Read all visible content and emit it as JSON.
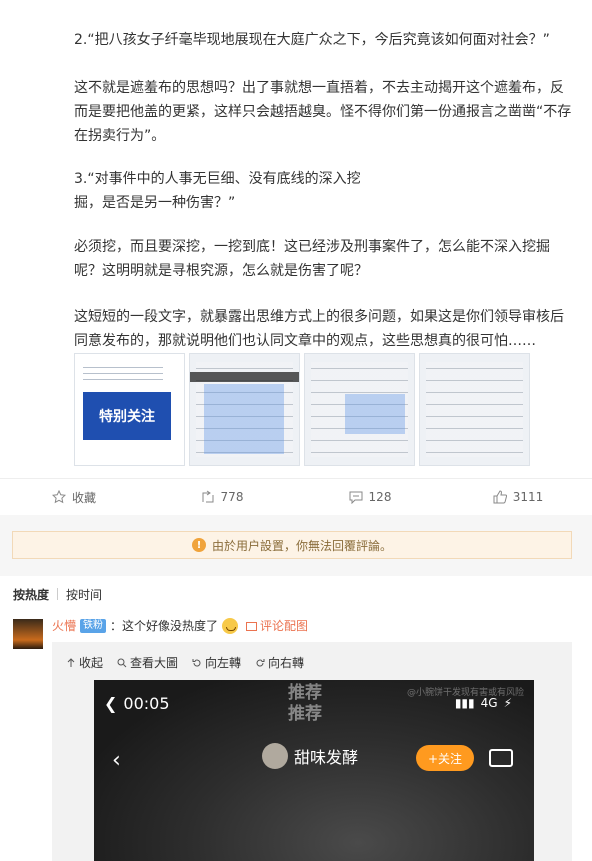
{
  "article": {
    "paragraphs": [
      "2.“把八孩女子纤毫毕现地展现在大庭广众之下，今后究竟该如何面对社会？”",
      "这不就是遮羞布的思想吗？出了事就想一直捂着，不去主动揭开这个遮羞布，反而是要把他盖的更紧，这样只会越捂越臭。怪不得你们第一份通报言之凿凿“不存在拐卖行为”。",
      "3.“对事件中的人事无巨细、没有底线的深入挖",
      "掘，是否是另一种伤害？”",
      "必须挖，而且要深挖，一挖到底！这已经涉及刑事案件了，怎么能不深入挖掘呢？这明明就是寻根究源，怎么就是伤害了呢？",
      "这短短的一段文字，就暴露出思维方式上的很多问题，如果这是你们领导审核后同意发布的，那就说明他们也认同文章中的观点，这些思想真的很可怕……"
    ],
    "thumbnails": [
      {
        "banner": "特别关注"
      },
      {},
      {},
      {}
    ]
  },
  "actions": [
    {
      "icon": "star-icon",
      "label": "收藏"
    },
    {
      "icon": "repost-icon",
      "label": "778"
    },
    {
      "icon": "comment-icon",
      "label": "128"
    },
    {
      "icon": "like-icon",
      "label": "3111"
    }
  ],
  "notice": {
    "icon": "alert-icon",
    "text": "由於用户設置，你無法回覆評論。"
  },
  "sort": {
    "hot": "按热度",
    "time": "按时间",
    "active": "hot"
  },
  "comment": {
    "username": "火懵",
    "badge": "铁粉",
    "text": "：这个好像没热度了",
    "emoji": "crying-face",
    "pic_link": "评论配图"
  },
  "viewer": {
    "tools": [
      "收起",
      "查看大圖",
      "向左轉",
      "向右轉"
    ]
  },
  "video": {
    "time": "00:05",
    "watermark_line1": "推荐",
    "watermark_line2": "推荐",
    "watermark_small": "@小腕饼干发现有害或有风险",
    "network": "4G",
    "user": "甜味发酵",
    "follow": "+关注"
  },
  "colors": {
    "accent": "#eb7350",
    "badge": "#59a3e8",
    "notice_bg": "#fdf3e6",
    "follow": "#ff9a1f"
  }
}
